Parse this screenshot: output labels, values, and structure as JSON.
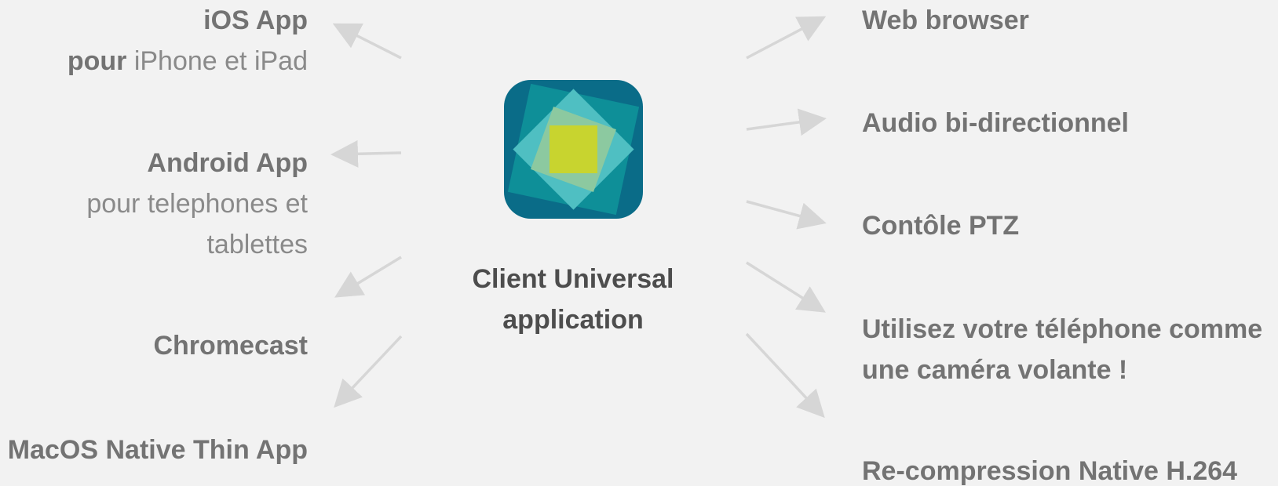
{
  "center": {
    "title_line1": "Client Universal",
    "title_line2": "application",
    "icon": "app-logo-icon",
    "colors": {
      "outer": "#0a6c88",
      "mid": "#0e8f98",
      "inner": "#4fbfc2",
      "core": "#c8d42f"
    }
  },
  "left": {
    "ios": {
      "bold": "iOS App",
      "sub_bold": "pour",
      "sub_rest": " iPhone et iPad"
    },
    "android": {
      "bold": "Android App",
      "sub_line1": "pour telephones et",
      "sub_line2": "tablettes"
    },
    "chromecast": {
      "bold": "Chromecast"
    },
    "macos": {
      "bold": "MacOS Native Thin App"
    }
  },
  "right": {
    "web": "Web browser",
    "audio": "Audio bi-directionnel",
    "ptz": "Contôle PTZ",
    "phone_line1": "Utilisez votre téléphone comme",
    "phone_line2": "une caméra volante !",
    "recompression": "Re-compression Native H.264"
  },
  "style": {
    "arrow_color": "#d6d6d6",
    "text_color": "#737373",
    "center_text_color": "#4d4d4d",
    "background": "#f2f2f2"
  }
}
